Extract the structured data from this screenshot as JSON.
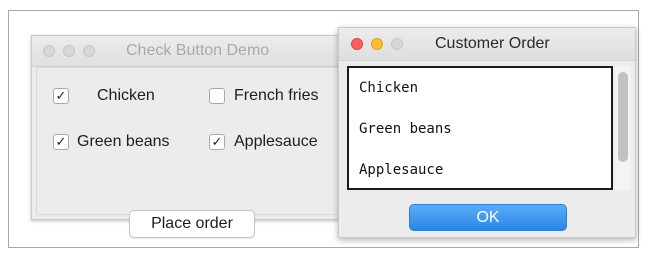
{
  "check_demo": {
    "title": "Check Button Demo",
    "options": [
      {
        "label": "Chicken",
        "checked": true,
        "check_mark": "✓"
      },
      {
        "label": "French fries",
        "checked": false,
        "check_mark": ""
      },
      {
        "label": "Green beans",
        "checked": true,
        "check_mark": "✓"
      },
      {
        "label": "Applesauce",
        "checked": true,
        "check_mark": "✓"
      }
    ],
    "place_order_label": "Place order"
  },
  "customer_order": {
    "title": "Customer Order",
    "items": [
      "Chicken",
      "Green beans",
      "Applesauce"
    ],
    "ok_label": "OK"
  },
  "colors": {
    "close": "#fc5f57",
    "minimize": "#fdbc2e",
    "zoom_inactive": "#d7d7d7",
    "ok_button": "#2b86e6"
  }
}
